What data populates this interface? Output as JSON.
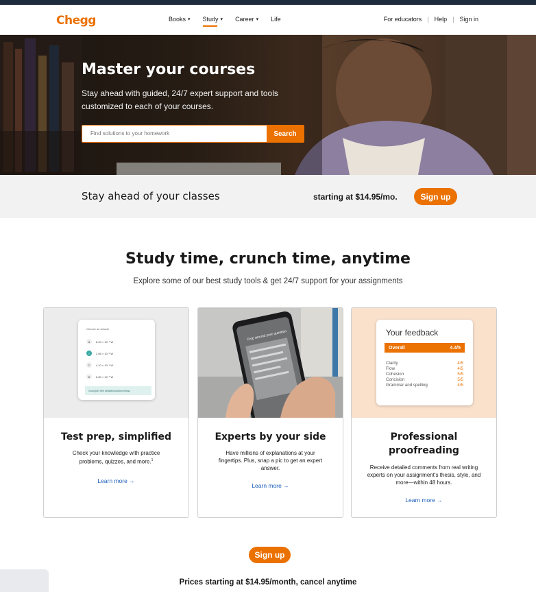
{
  "brand": {
    "logo": "Chegg",
    "accent": "#eb7100",
    "link_color": "#1a5cb8"
  },
  "nav": {
    "items": [
      {
        "label": "Books",
        "caret": "▾"
      },
      {
        "label": "Study",
        "caret": "▾"
      },
      {
        "label": "Career",
        "caret": "▾"
      },
      {
        "label": "Life",
        "caret": ""
      }
    ],
    "active": "Study",
    "right": {
      "educators": "For educators",
      "sep": "|",
      "help": "Help",
      "signin": "Sign in"
    }
  },
  "hero": {
    "title": "Master your courses",
    "subtitle": "Stay ahead with guided, 24/7 expert support and tools customized to each of your courses.",
    "search_placeholder": "Find solutions to your homework",
    "search_button": "Search"
  },
  "band": {
    "left": "Stay ahead of your classes",
    "right": "starting at $14.95/mo.",
    "button": "Sign up"
  },
  "section": {
    "title": "Study time, crunch time, anytime",
    "subtitle": "Explore some of our best study tools & get 24/7 support for your assignments"
  },
  "cards": [
    {
      "title": "Test prep, simplified",
      "desc": "Check your knowledge with practice problems, quizzes, and more.",
      "sup": "1",
      "link": "Learn more",
      "arrow": "→",
      "mock": {
        "question": "Choose an answer",
        "options": [
          {
            "letter": "A",
            "text": "8.20 × 10⁻¹ W"
          },
          {
            "letter": "✓",
            "text": "2.66 × 10⁻¹ W"
          },
          {
            "letter": "C",
            "text": "4.10 × 10⁻¹ W"
          },
          {
            "letter": "D",
            "text": "6.60 × 10⁻¹ W"
          }
        ],
        "feedback": "Good job! See detailed solution below."
      }
    },
    {
      "title": "Experts by your side",
      "desc": "Have millions of explanations at your fingertips. Plus, snap a pic to get an expert answer.",
      "link": "Learn more",
      "arrow": "→",
      "mock": {
        "phone_header": "Crop around your question"
      }
    },
    {
      "title": "Professional proofreading",
      "desc": "Receive detailed comments from real writing experts on your assignment's thesis, style, and more—within 48 hours.",
      "link": "Learn more",
      "arrow": "→",
      "mock": {
        "title": "Your feedback",
        "overall_label": "Overall",
        "overall_value": "4.4/5",
        "rows": [
          {
            "label": "Clarity",
            "value": "4/5"
          },
          {
            "label": "Flow",
            "value": "4/5"
          },
          {
            "label": "Cohesion",
            "value": "5/5"
          },
          {
            "label": "Concision",
            "value": "5/5"
          },
          {
            "label": "Grammar and spelling",
            "value": "4/5"
          }
        ]
      }
    }
  ],
  "footer_cta": {
    "button": "Sign up",
    "text": "Prices starting at $14.95/month, cancel anytime"
  }
}
